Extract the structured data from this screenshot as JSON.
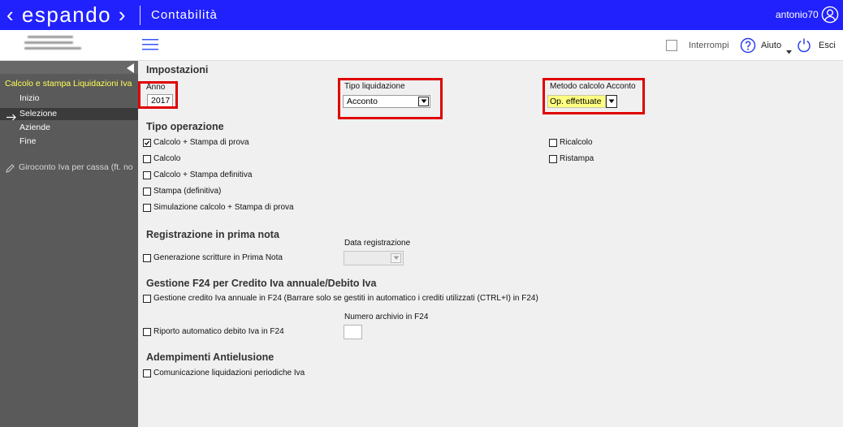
{
  "colors": {
    "topbar": "#2121fd",
    "sidebar": "#5a5a5a",
    "sidebar_active": "#3b3b3b",
    "sidebar_title": "#ffff55",
    "main_background": "#f0f0f0",
    "highlight_border": "#e00000",
    "select_highlight": "#ffff80",
    "icon_blue": "#2b3df2"
  },
  "topbar": {
    "logo": "‹ espando ›",
    "module": "Contabilità",
    "user": "antonio70",
    "user_icon": "user-icon"
  },
  "toolbar": {
    "menu_icon": "hamburger-menu-icon",
    "interrompi": {
      "label": "Interrompi",
      "checked": false
    },
    "aiuto": {
      "label": "Aiuto",
      "icon": "question-icon",
      "dropdown_icon": "caret-down-icon"
    },
    "esci": {
      "label": "Esci",
      "icon": "power-icon"
    }
  },
  "sidebar": {
    "collapse_icon": "collapse-left-icon",
    "section_title": "Calcolo e stampa Liquidazioni Iva",
    "steps": [
      {
        "label": "Inizio",
        "active": false
      },
      {
        "label": "Selezione",
        "active": true,
        "icon": "arrow-right-icon"
      },
      {
        "label": "Aziende",
        "active": false
      },
      {
        "label": "Fine",
        "active": false
      }
    ],
    "other_task": {
      "label": "Giroconto Iva per cassa (ft. no",
      "icon": "pencil-icon"
    }
  },
  "impostazioni": {
    "title": "Impostazioni",
    "anno": {
      "label": "Anno",
      "value": "2017"
    },
    "tipo_liquidazione": {
      "label": "Tipo liquidazione",
      "value": "Acconto"
    },
    "metodo_calcolo_acconto": {
      "label": "Metodo calcolo Acconto",
      "value": "Op. effettuate"
    }
  },
  "tipo_operazione": {
    "title": "Tipo operazione",
    "options": [
      {
        "label": "Calcolo + Stampa di prova",
        "checked": true
      },
      {
        "label": "Calcolo",
        "checked": false
      },
      {
        "label": "Calcolo + Stampa definitiva",
        "checked": false
      },
      {
        "label": "Stampa (definitiva)",
        "checked": false
      },
      {
        "label": "Simulazione calcolo + Stampa di prova",
        "checked": false
      },
      {
        "label": "Ricalcolo",
        "checked": false
      },
      {
        "label": "Ristampa",
        "checked": false
      }
    ]
  },
  "registrazione_prima_nota": {
    "title": "Registrazione in prima nota",
    "generazione_scritture": {
      "label": "Generazione scritture in Prima Nota",
      "checked": false
    },
    "data_registrazione": {
      "label": "Data registrazione",
      "value": "",
      "disabled": true
    }
  },
  "gestione_f24": {
    "title": "Gestione F24 per Credito Iva annuale/Debito Iva",
    "gestione_credito": {
      "label": "Gestione credito Iva annuale in F24 (Barrare solo se gestiti in automatico i crediti utilizzati (CTRL+I) in F24)",
      "checked": false
    },
    "riporto_debito": {
      "label": "Riporto automatico debito Iva in F24",
      "checked": false
    },
    "numero_archivio": {
      "label": "Numero archivio in F24",
      "value": ""
    }
  },
  "adempimenti_antielusione": {
    "title": "Adempimenti Antielusione",
    "comunicazione_liquidazioni": {
      "label": "Comunicazione liquidazioni periodiche Iva",
      "checked": false
    }
  }
}
